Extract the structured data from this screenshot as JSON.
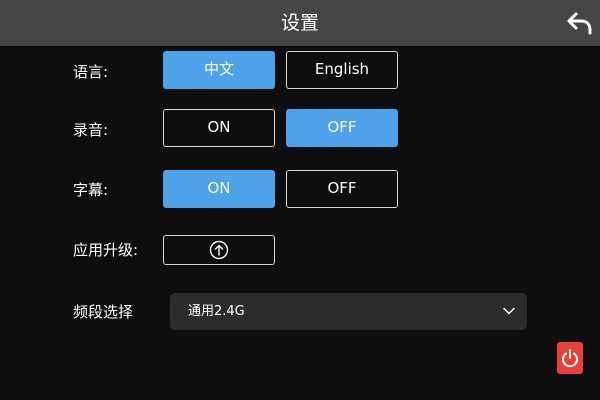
{
  "header": {
    "title": "设置",
    "back_icon": "back-arrow-icon"
  },
  "colors": {
    "accent": "#4da2ea",
    "header_bg": "#454545",
    "background": "#0e0e0e",
    "power": "#e8403a"
  },
  "settings": {
    "language": {
      "label": "语言:",
      "options": [
        "中文",
        "English"
      ],
      "selected": "中文"
    },
    "recording": {
      "label": "录音:",
      "options": [
        "ON",
        "OFF"
      ],
      "selected": "OFF"
    },
    "subtitle": {
      "label": "字幕:",
      "options": [
        "ON",
        "OFF"
      ],
      "selected": "ON"
    },
    "upgrade": {
      "label": "应用升级:",
      "icon": "upload-arrow-icon"
    },
    "band": {
      "label": "频段选择",
      "value": "通用2.4G",
      "icon": "chevron-down-icon"
    }
  },
  "power": {
    "icon": "power-icon"
  }
}
